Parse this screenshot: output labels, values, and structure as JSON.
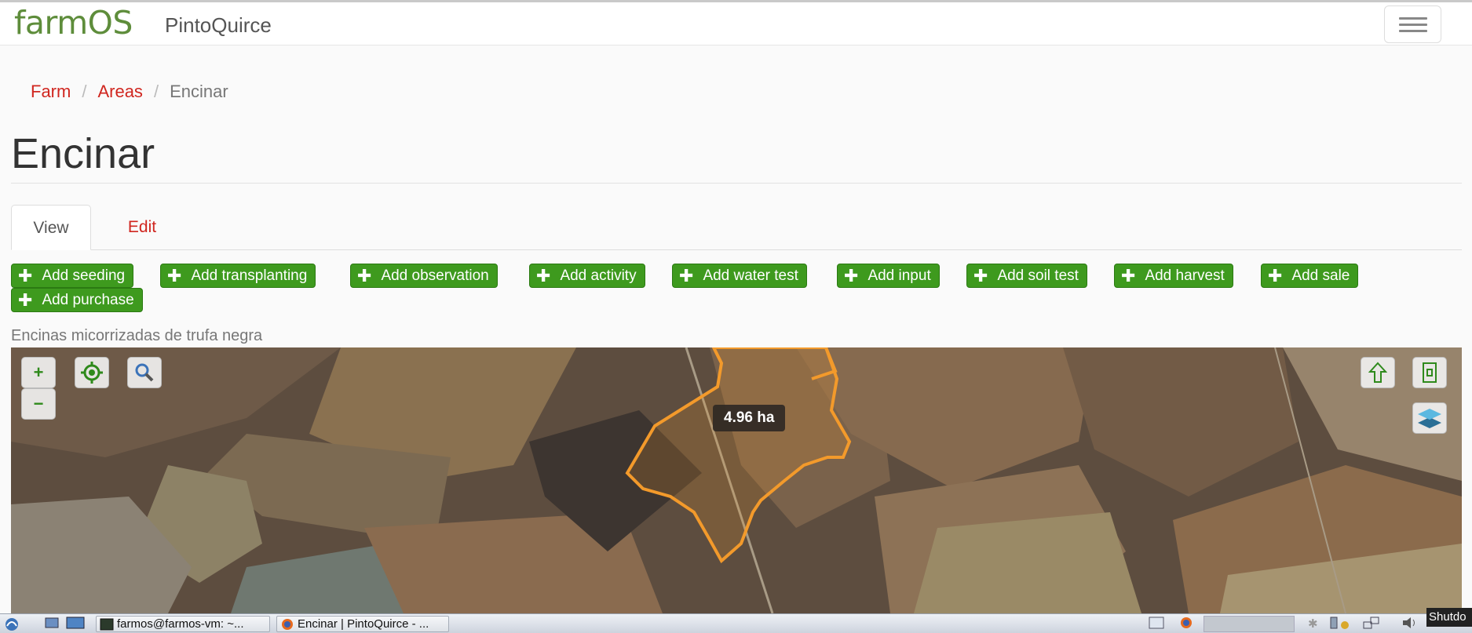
{
  "header": {
    "logo_text": "farmOS",
    "site_name": "PintoQuirce",
    "menu_icon": "hamburger-icon"
  },
  "breadcrumb": {
    "items": [
      "Farm",
      "Areas"
    ],
    "current": "Encinar",
    "separator": "/"
  },
  "page": {
    "title": "Encinar",
    "description": "Encinas micorrizadas de trufa negra"
  },
  "tabs": {
    "view": "View",
    "edit": "Edit"
  },
  "actions": {
    "plus_glyph": "✚",
    "buttons": [
      "Add seeding",
      "Add transplanting",
      "Add observation",
      "Add activity",
      "Add water test",
      "Add input",
      "Add soil test",
      "Add harvest",
      "Add sale",
      "Add purchase"
    ]
  },
  "map": {
    "area_label": "4.96 ha",
    "zoom_in": "+",
    "zoom_out": "−",
    "geolocate_icon": "crosshair-icon",
    "search_icon": "search-icon",
    "upload_icon": "upload-arrow-icon",
    "fullscreen_icon": "fullscreen-icon",
    "layers_icon": "layers-icon",
    "boundary_color": "#f39a2b"
  },
  "taskbar": {
    "terminal_title": "farmos@farmos-vm: ~...",
    "browser_title": "Encinar | PintoQuirce - ...",
    "tooltip": "Shutdo"
  },
  "colors": {
    "brand_green": "#5e8d3b",
    "button_green": "#3e9a1e",
    "link_red": "#d0261f"
  }
}
